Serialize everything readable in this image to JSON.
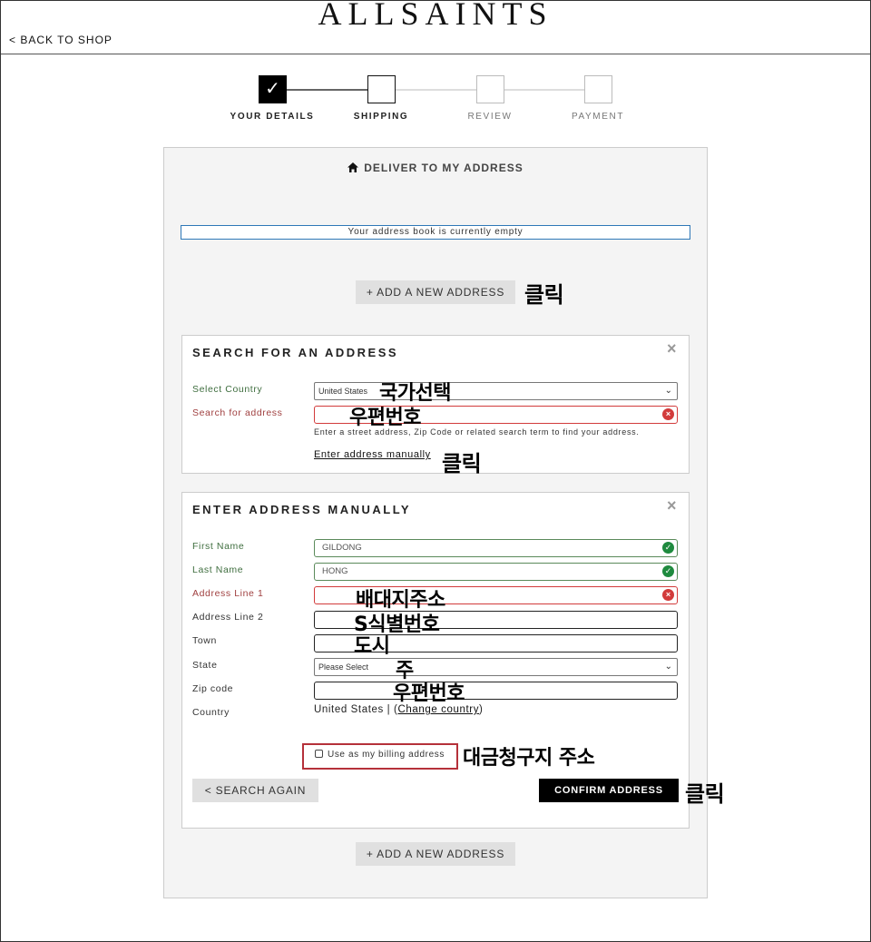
{
  "header": {
    "brand": "ALLSAINTS",
    "back_link": "< BACK TO SHOP"
  },
  "steps": [
    {
      "label": "YOUR DETAILS",
      "state": "complete",
      "mark": "✓"
    },
    {
      "label": "SHIPPING",
      "state": "active"
    },
    {
      "label": "REVIEW",
      "state": "pending"
    },
    {
      "label": "PAYMENT",
      "state": "pending"
    }
  ],
  "deliver": {
    "title": "DELIVER TO MY ADDRESS",
    "icon": "home-icon",
    "address_book_notice": "Your address book is currently empty",
    "add_address_label": "+ ADD A NEW ADDRESS"
  },
  "search_card": {
    "title": "SEARCH FOR AN ADDRESS",
    "close": "×",
    "country_label": "Select Country",
    "country_value": "United States",
    "search_label": "Search for address",
    "search_value": "",
    "hint": "Enter a street address, Zip Code or related search term to find your address.",
    "manual_link": "Enter address manually"
  },
  "manual_card": {
    "title": "ENTER ADDRESS MANUALLY",
    "close": "×",
    "fields": {
      "first_name": {
        "label": "First Name",
        "value": "GILDONG"
      },
      "last_name": {
        "label": "Last Name",
        "value": "HONG"
      },
      "address1": {
        "label": "Address Line 1",
        "value": ""
      },
      "address2": {
        "label": "Address Line 2",
        "value": ""
      },
      "town": {
        "label": "Town",
        "value": ""
      },
      "state": {
        "label": "State",
        "value": "Please Select"
      },
      "zip": {
        "label": "Zip code",
        "value": ""
      },
      "country": {
        "label": "Country",
        "value": "United States",
        "separator": " | (",
        "change_link": "Change country",
        "close_paren": ")"
      }
    },
    "billing_label": "Use as my billing address",
    "search_again_label": "< SEARCH AGAIN",
    "confirm_label": "CONFIRM ADDRESS"
  },
  "bottom_add_address_label": "+ ADD A NEW ADDRESS",
  "annotations": {
    "click_add": "클릭",
    "country": "국가선택",
    "postcode_search": "우편번호",
    "click_manual": "클릭",
    "address1": "배대지주소",
    "address2": "S식별번호",
    "town": "도시",
    "state": "주",
    "zip": "우편번호",
    "billing": "대금청구지 주소",
    "click_confirm": "클릭"
  },
  "colors": {
    "accent_blue": "#2e78b7",
    "error_red": "#d23b3b",
    "success_green": "#1e8a3e",
    "highlight_red": "#b5313a"
  }
}
